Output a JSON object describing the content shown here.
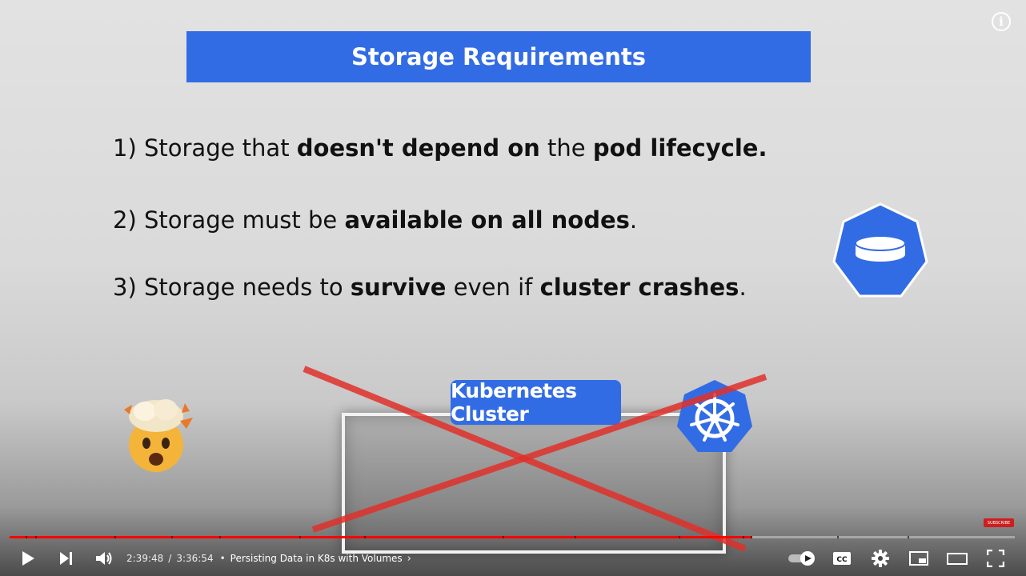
{
  "slide": {
    "title": "Storage Requirements",
    "requirements": [
      {
        "prefix": "1) Storage that ",
        "bold1": "doesn't depend on",
        "mid": " the ",
        "bold2": "pod lifecycle.",
        "suffix": ""
      },
      {
        "prefix": "2) Storage must be ",
        "bold1": "available on all nodes",
        "mid": "",
        "bold2": "",
        "suffix": "."
      },
      {
        "prefix": "3) Storage needs to ",
        "bold1": "survive",
        "mid": " even if ",
        "bold2": "cluster crashes",
        "suffix": "."
      }
    ],
    "cluster_label": "Kubernetes Cluster",
    "accent": "#326ce5",
    "cross_color": "#e0302a"
  },
  "icons": {
    "info": "info-icon",
    "storage": "storage-volume-icon",
    "kubernetes": "kubernetes-logo-icon",
    "emoji": "exploding-head-emoji-icon"
  },
  "player": {
    "info_glyph": "i",
    "subscribe_label": "SUBSCRIBE",
    "current_time": "2:39:48",
    "separator": "/",
    "duration": "3:36:54",
    "bullet": "•",
    "chapter": "Persisting Data in K8s with Volumes",
    "chapter_chevron": "›",
    "progress_fraction": 0.738,
    "progress_color": "#ff0000",
    "autoplay_on": true
  }
}
